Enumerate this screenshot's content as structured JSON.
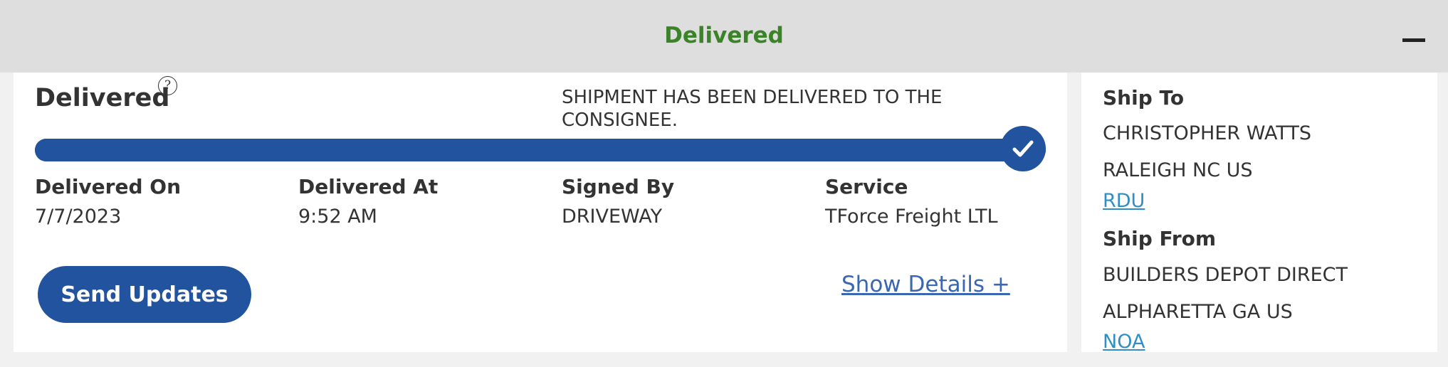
{
  "header": {
    "title": "Delivered",
    "title_color": "#3b8327",
    "collapse_icon": "minus-icon"
  },
  "status": {
    "title": "Delivered",
    "help_icon": "question-mark-icon",
    "help_glyph": "?",
    "message": "SHIPMENT HAS BEEN DELIVERED TO THE CONSIGNEE.",
    "progress_fraction": 1.0,
    "progress_complete_icon": "checkmark-icon",
    "accent_color": "#21539e"
  },
  "details": [
    {
      "label": "Delivered On",
      "value": "7/7/2023"
    },
    {
      "label": "Delivered At",
      "value": "9:52 AM"
    },
    {
      "label": "Signed By",
      "value": "DRIVEWAY"
    },
    {
      "label": "Service",
      "value": "TForce Freight LTL"
    }
  ],
  "actions": {
    "send_updates": "Send Updates",
    "show_details": "Show Details +"
  },
  "ship_to": {
    "label": "Ship To",
    "name": "CHRISTOPHER WATTS",
    "location": "RALEIGH NC US",
    "terminal": "RDU"
  },
  "ship_from": {
    "label": "Ship From",
    "name": "BUILDERS DEPOT DIRECT",
    "location": "ALPHARETTA GA US",
    "terminal": "NOA"
  }
}
